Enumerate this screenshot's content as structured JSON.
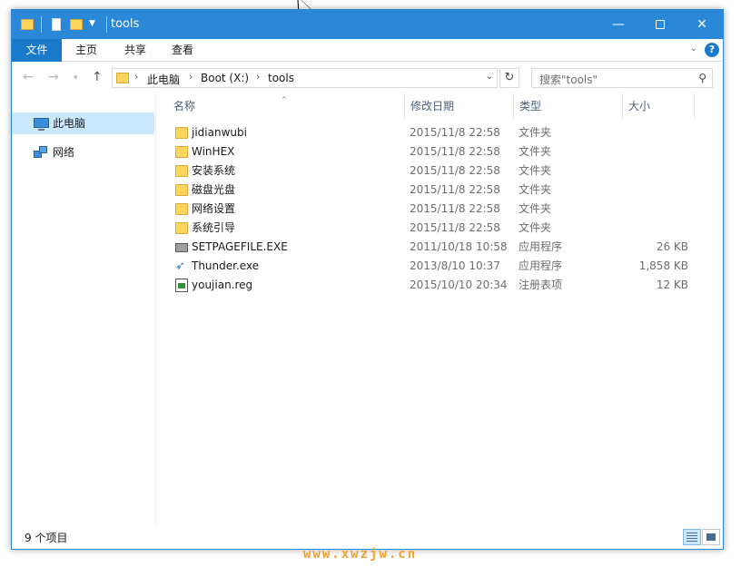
{
  "window": {
    "title": "tools"
  },
  "ribbon": {
    "tabs": [
      {
        "label": "文件"
      },
      {
        "label": "主页"
      },
      {
        "label": "共享"
      },
      {
        "label": "查看"
      }
    ],
    "help": "?"
  },
  "address": {
    "crumbs": [
      "此电脑",
      "Boot (X:)",
      "tools"
    ]
  },
  "search": {
    "placeholder": "搜索\"tools\""
  },
  "sidebar": {
    "items": [
      {
        "label": "此电脑",
        "icon": "computer-icon",
        "selected": true
      },
      {
        "label": "网络",
        "icon": "network-icon",
        "selected": false
      }
    ]
  },
  "columns": {
    "name": "名称",
    "date": "修改日期",
    "type": "类型",
    "size": "大小"
  },
  "files": [
    {
      "name": "jidianwubi",
      "date": "2015/11/8 22:58",
      "type": "文件夹",
      "size": "",
      "icon": "folder-icon"
    },
    {
      "name": "WinHEX",
      "date": "2015/11/8 22:58",
      "type": "文件夹",
      "size": "",
      "icon": "folder-icon"
    },
    {
      "name": "安装系统",
      "date": "2015/11/8 22:58",
      "type": "文件夹",
      "size": "",
      "icon": "folder-icon"
    },
    {
      "name": "磁盘光盘",
      "date": "2015/11/8 22:58",
      "type": "文件夹",
      "size": "",
      "icon": "folder-icon"
    },
    {
      "name": "网络设置",
      "date": "2015/11/8 22:58",
      "type": "文件夹",
      "size": "",
      "icon": "folder-icon"
    },
    {
      "name": "系统引导",
      "date": "2015/11/8 22:58",
      "type": "文件夹",
      "size": "",
      "icon": "folder-icon"
    },
    {
      "name": "SETPAGEFILE.EXE",
      "date": "2011/10/18 10:58",
      "type": "应用程序",
      "size": "26 KB",
      "icon": "exe-icon"
    },
    {
      "name": "Thunder.exe",
      "date": "2013/8/10 10:37",
      "type": "应用程序",
      "size": "1,858 KB",
      "icon": "thunder-icon"
    },
    {
      "name": "youjian.reg",
      "date": "2015/10/10 20:34",
      "type": "注册表项",
      "size": "12 KB",
      "icon": "registry-icon"
    }
  ],
  "status": {
    "count": "9 个项目"
  },
  "watermark": "www.xwzjw.cn",
  "colors": {
    "accent": "#2b88d8",
    "file_tab": "#1979ca",
    "selection": "#cce8ff",
    "folder": "#ffd65c"
  }
}
